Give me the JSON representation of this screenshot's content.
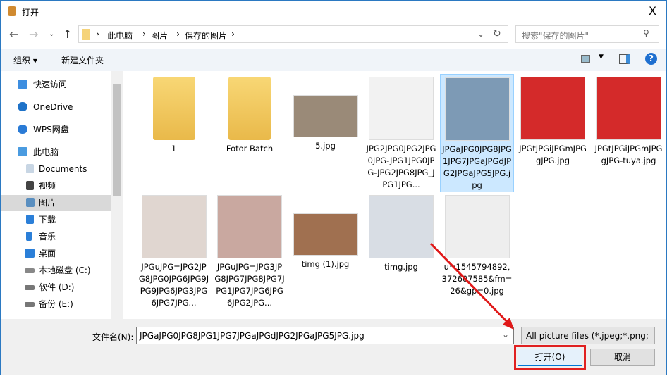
{
  "window": {
    "title": "打开",
    "close": "X"
  },
  "address": {
    "crumbs": [
      "此电脑",
      "图片",
      "保存的图片"
    ],
    "search_placeholder": "搜索\"保存的图片\""
  },
  "toolbar": {
    "organize": "组织 ▾",
    "new_folder": "新建文件夹"
  },
  "sidebar": {
    "items": [
      {
        "label": "快速访问",
        "color": "#3d8ee0"
      },
      {
        "label": "OneDrive",
        "color": "#1e72c8"
      },
      {
        "label": "WPS网盘",
        "color": "#2a7bd6"
      },
      {
        "label": "此电脑",
        "color": "#4a9be0"
      },
      {
        "label": "Documents",
        "color": "#9cb4cc"
      },
      {
        "label": "视频",
        "color": "#444"
      },
      {
        "label": "图片",
        "color": "#5a8fc0"
      },
      {
        "label": "下载",
        "color": "#2b7fd8"
      },
      {
        "label": "音乐",
        "color": "#2b7fd8"
      },
      {
        "label": "桌面",
        "color": "#2b7fd8"
      },
      {
        "label": "本地磁盘 (C:)",
        "color": "#888"
      },
      {
        "label": "软件 (D:)",
        "color": "#777"
      },
      {
        "label": "备份 (E:)",
        "color": "#777"
      }
    ]
  },
  "files": [
    {
      "name": "1",
      "kind": "folder"
    },
    {
      "name": "Fotor Batch",
      "kind": "folder"
    },
    {
      "name": "5.jpg",
      "color": "#9a8a78"
    },
    {
      "name": "JPG2JPG0JPG2JPG0JPG-JPG1JPG0JPG-JPG2JPG8JPG_JPG1JPG...",
      "color": "#f2f2f2"
    },
    {
      "name": "JPGaJPG0JPG8JPG1JPG7JPGaJPGdJPG2JPGaJPG5JPG.jpg",
      "color": "#7d9ab5",
      "selected": true
    },
    {
      "name": "JPGtJPGiJPGmJPGgJPG.jpg",
      "color": "#d42a2a"
    },
    {
      "name": "JPGtJPGiJPGmJPGgJPG-tuya.jpg",
      "color": "#d42a2a"
    },
    {
      "name": "JPGuJPG=JPG2JPG8JPG0JPG6JPG9JPG9JPG6JPG3JPG6JPG7JPG...",
      "color": "#e0d6d0"
    },
    {
      "name": "JPGuJPG=JPG3JPG8JPG7JPG8JPG7JPG1JPG7JPG6JPG6JPG2JPG...",
      "color": "#c9a8a0"
    },
    {
      "name": "timg (1).jpg",
      "color": "#a07050"
    },
    {
      "name": "timg.jpg",
      "color": "#d8dde4"
    },
    {
      "name": "u=1545794892,372607585&fm=26&gp=0.jpg",
      "color": "#eeeeee"
    }
  ],
  "bottom": {
    "filename_label": "文件名(N):",
    "filename": "JPGaJPG0JPG8JPG1JPG7JPGaJPGdJPG2JPGaJPG5JPG.jpg",
    "filetype": "All picture files (*.jpeg;*.png;",
    "open": "打开(O)",
    "cancel": "取消"
  }
}
